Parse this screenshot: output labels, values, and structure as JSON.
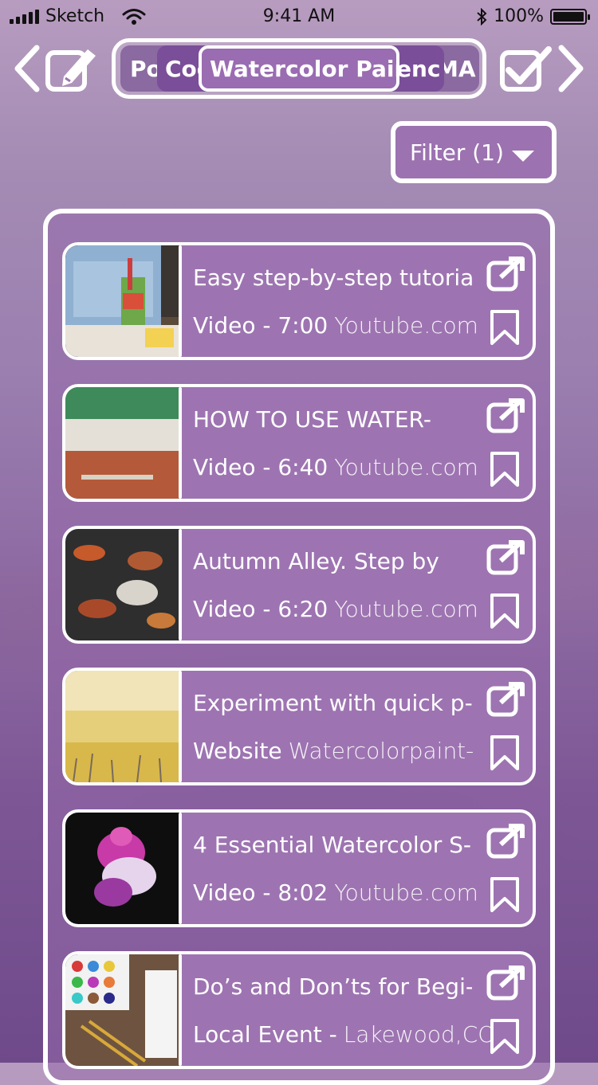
{
  "status_bar": {
    "carrier": "Sketch",
    "time": "9:41 AM",
    "battery": "100%"
  },
  "topic_tabs": [
    {
      "label": "Po"
    },
    {
      "label": "Coo"
    },
    {
      "label": "Watercolor Paint-"
    },
    {
      "label": "enc"
    },
    {
      "label": "MA"
    }
  ],
  "filter": {
    "label": "Filter (1)"
  },
  "results": [
    {
      "title": "Easy step-by-step tutorial-",
      "type": "Video - 7:00",
      "source": "Youtube.com",
      "thumb": "paint-brush-cup"
    },
    {
      "title": "HOW TO USE WATER-",
      "type": "Video - 6:40",
      "source": "Youtube.com",
      "thumb": "painted-wall"
    },
    {
      "title": "Autumn Alley. Step by",
      "type": "Video - 6:20",
      "source": "Youtube.com",
      "thumb": "autumn-leaves"
    },
    {
      "title": "Experiment with quick p-",
      "type": "Website",
      "source": "Watercolorpaint-",
      "thumb": "yellow-wash"
    },
    {
      "title": "4 Essential Watercolor S-",
      "type": "Video - 8:02",
      "source": "Youtube.com",
      "thumb": "ink-in-water"
    },
    {
      "title": "Do’s and Don’ts for Begi-",
      "type": "Local Event -",
      "source": "Lakewood,CO",
      "thumb": "paint-palette"
    }
  ],
  "colors": {
    "accent": "#9d74b1",
    "tab_dark": "#7a4e98",
    "outline": "#ffffff"
  },
  "icons": [
    "chevron-left-icon",
    "edit-icon",
    "checkbox-icon",
    "chevron-right-icon",
    "caret-down-icon",
    "external-link-icon",
    "bookmark-icon"
  ]
}
